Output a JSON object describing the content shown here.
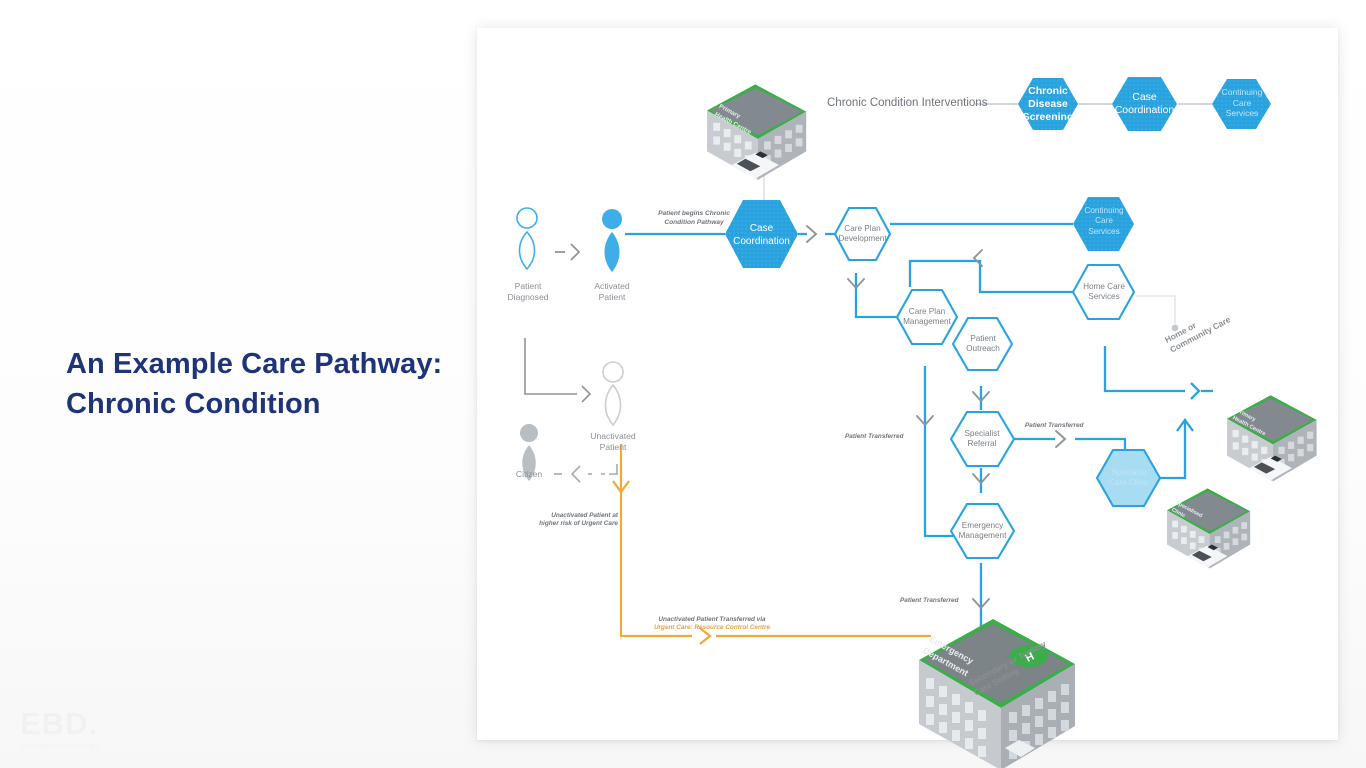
{
  "slide": {
    "title_line1": "An Example Care Pathway:",
    "title_line2": "Chronic Condition",
    "title_color": "#1F3379",
    "logo_main": "EBD.",
    "logo_sub": "EconomicsByDesign"
  },
  "colors": {
    "primary_blue": "#29A3E0",
    "light_blue_fill": "#A7DCF2",
    "orange": "#F2A93B",
    "gray_line": "#8E9499",
    "label_gray": "#7A7F85",
    "roof_green": "#3BAE49"
  },
  "legend": {
    "label": "Chronic Condition Interventions",
    "items": [
      {
        "label_lines": [
          "Chronic",
          "Disease",
          "Screening"
        ],
        "fill": "#29A3E0",
        "text": "#ffffff"
      },
      {
        "label_lines": [
          "Case",
          "Coordination"
        ],
        "fill": "#29A3E0",
        "text": "#ffffff"
      },
      {
        "label_lines": [
          "Continuing",
          "Care",
          "Services"
        ],
        "fill": "#29A3E0",
        "text": "#d9f0fb"
      }
    ]
  },
  "personas": [
    {
      "name": "patient-diagnosed",
      "label_lines": [
        "Patient",
        "Diagnosed"
      ],
      "style": "outline-blue"
    },
    {
      "name": "activated-patient",
      "label_lines": [
        "Activated",
        "Patient"
      ],
      "style": "filled-blue"
    },
    {
      "name": "unactivated-patient",
      "label_lines": [
        "Unactivated",
        "Patient"
      ],
      "style": "outline-gray"
    },
    {
      "name": "citizen",
      "label_lines": [
        "Citizen"
      ],
      "style": "filled-gray"
    }
  ],
  "nodes": [
    {
      "id": "case-coordination",
      "label_lines": [
        "Case",
        "Coordination"
      ],
      "fill": "#29A3E0",
      "text": "#ffffff"
    },
    {
      "id": "care-plan-development",
      "label_lines": [
        "Care Plan",
        "Development"
      ],
      "fill": "none",
      "text": "#7A7F85"
    },
    {
      "id": "care-plan-management",
      "label_lines": [
        "Care Plan",
        "Management"
      ],
      "fill": "none",
      "text": "#7A7F85"
    },
    {
      "id": "patient-outreach",
      "label_lines": [
        "Patient",
        "Outreach"
      ],
      "fill": "none",
      "text": "#7A7F85"
    },
    {
      "id": "specialist-referral",
      "label_lines": [
        "Specialist",
        "Referral"
      ],
      "fill": "none",
      "text": "#7A7F85"
    },
    {
      "id": "emergency-management",
      "label_lines": [
        "Emergency",
        "Management"
      ],
      "fill": "none",
      "text": "#7A7F85"
    },
    {
      "id": "continuing-care-services",
      "label_lines": [
        "Continuing",
        "Care",
        "Services"
      ],
      "fill": "#29A3E0",
      "text": "#d9f0fb"
    },
    {
      "id": "home-care-services",
      "label_lines": [
        "Home Care",
        "Services"
      ],
      "fill": "none",
      "text": "#7A7F85"
    },
    {
      "id": "specialist-care-clinic",
      "label_lines": [
        "Specialist",
        "Care Clinic"
      ],
      "fill": "#A7DCF2",
      "text": "#cdeaf8"
    }
  ],
  "edge_labels": {
    "patient_begins": [
      "Patient begins Chronic",
      "Condition Pathway"
    ],
    "patient_transferred_1": "Patient Transferred",
    "patient_transferred_2": "Patient Transferred",
    "patient_transferred_3": "Patient Transferred",
    "unactivated_risk": [
      "Unactivated Patient at",
      "higher risk of Urgent Care"
    ],
    "unactivated_transfer_line1": "Unactivated Patient Transferred via",
    "unactivated_transfer_line2": "Urgent Care: Resource Control Centre"
  },
  "settings": {
    "home_or_community": [
      "Home or",
      "Community Care"
    ],
    "secondary_tertiary": [
      "Secondary or Tertiary",
      "Care Setting"
    ]
  },
  "buildings": [
    {
      "id": "primary-health-centre-top",
      "label_lines": [
        "Primary",
        "Health Centre"
      ]
    },
    {
      "id": "primary-health-centre-right",
      "label_lines": [
        "Primary",
        "Health Centre"
      ]
    },
    {
      "id": "specialised-clinic",
      "label_lines": [
        "Specialised",
        "Clinic"
      ]
    },
    {
      "id": "emergency-department",
      "label_lines": [
        "Emergency",
        "Department"
      ],
      "helipad": "H"
    }
  ]
}
